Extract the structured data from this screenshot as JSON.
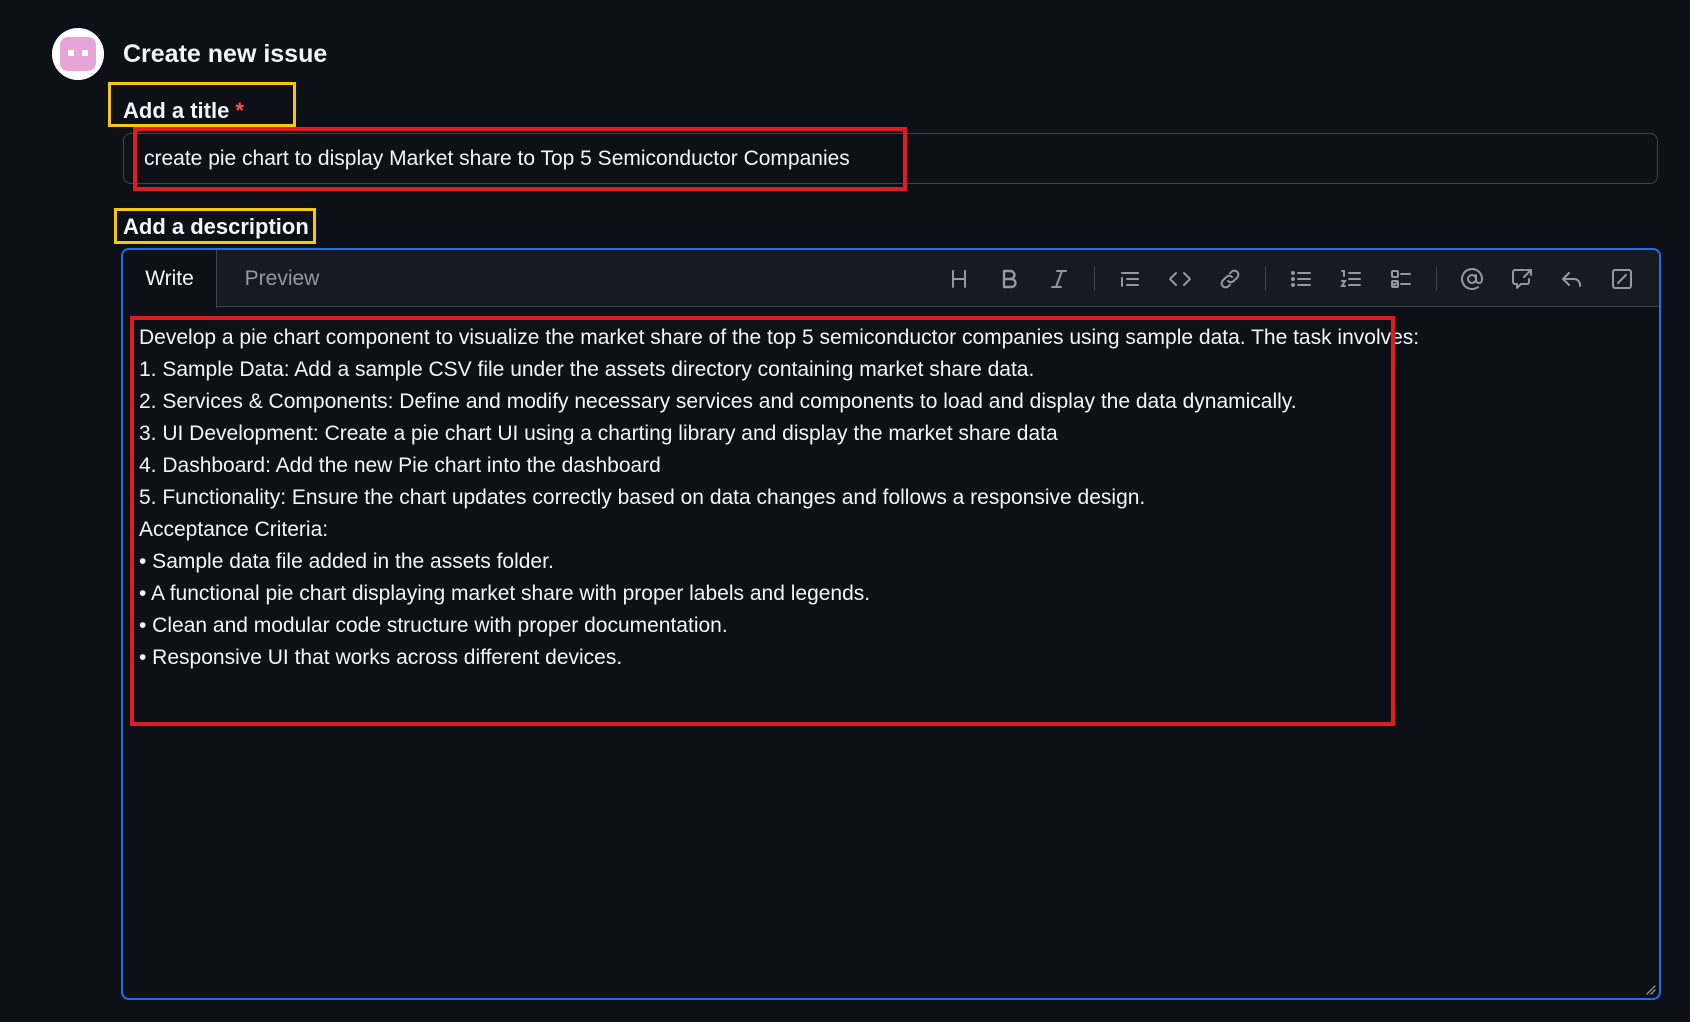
{
  "header": {
    "title": "Create new issue",
    "avatar_icon": "bot-avatar-icon"
  },
  "title_field": {
    "label": "Add a title",
    "required_mark": "*",
    "value": "create pie chart to display Market share to Top 5 Semiconductor Companies"
  },
  "description_field": {
    "label": "Add a description",
    "tabs": [
      {
        "label": "Write",
        "active": true
      },
      {
        "label": "Preview",
        "active": false
      }
    ],
    "toolbar": [
      {
        "name": "heading",
        "icon": "heading-icon"
      },
      {
        "name": "bold",
        "icon": "bold-icon"
      },
      {
        "name": "italic",
        "icon": "italic-icon"
      },
      {
        "name": "quote",
        "icon": "quote-icon"
      },
      {
        "name": "code",
        "icon": "code-icon"
      },
      {
        "name": "link",
        "icon": "link-icon"
      },
      {
        "name": "unordered-list",
        "icon": "unordered-list-icon"
      },
      {
        "name": "ordered-list",
        "icon": "ordered-list-icon"
      },
      {
        "name": "task-list",
        "icon": "task-list-icon"
      },
      {
        "name": "mention",
        "icon": "mention-icon"
      },
      {
        "name": "reference",
        "icon": "cross-reference-icon"
      },
      {
        "name": "undo",
        "icon": "reply-icon"
      },
      {
        "name": "fullscreen",
        "icon": "fullscreen-icon"
      }
    ],
    "value": "Develop a pie chart component to visualize the market share of the top 5 semiconductor companies using sample data. The task involves:\n1. Sample Data: Add a sample CSV file under the assets directory containing market share data.\n2. Services & Components: Define and modify necessary services and components to load and display the data dynamically.\n3. UI Development: Create a pie chart UI using a charting library and display the market share data\n4. Dashboard: Add the new Pie chart into the dashboard\n5. Functionality: Ensure the chart updates correctly based on data changes and follows a responsive design.\nAcceptance Criteria:\n• Sample data file added in the assets folder.\n• A functional pie chart displaying market share with proper labels and legends.\n• Clean and modular code structure with proper documentation.\n• Responsive UI that works across different devices."
  },
  "colors": {
    "background": "#0d1117",
    "focus_border": "#1f6feb",
    "highlight_yellow": "#f5c518",
    "highlight_red": "#e01b24",
    "required": "#f85149"
  }
}
